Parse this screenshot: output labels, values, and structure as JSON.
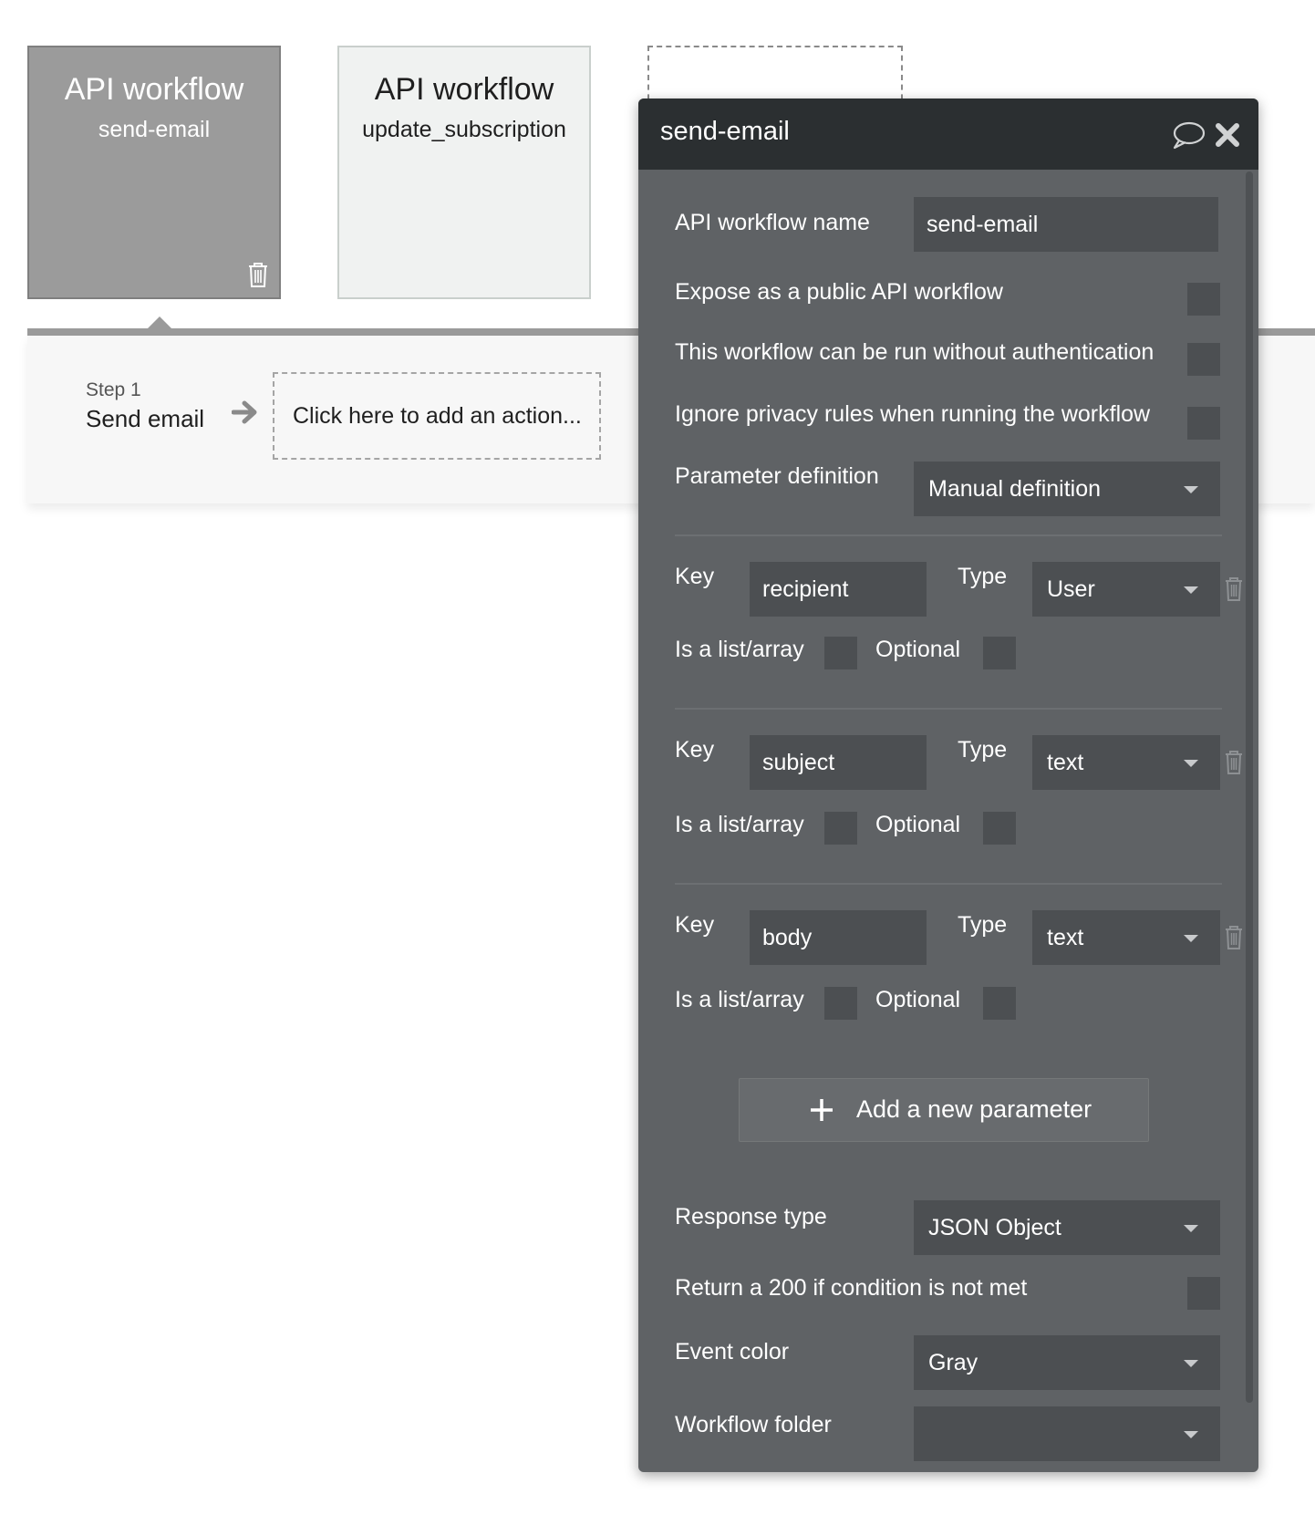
{
  "cards": [
    {
      "title": "API workflow",
      "subtitle": "send-email"
    },
    {
      "title": "API workflow",
      "subtitle": "update_subscription"
    }
  ],
  "step": {
    "number": "Step 1",
    "name": "Send email",
    "add_action": "Click here to add an action..."
  },
  "panel": {
    "title": "send-email",
    "workflow_name_label": "API workflow name",
    "workflow_name_value": "send-email",
    "expose_label": "Expose as a public API workflow",
    "no_auth_label": "This workflow can be run without authentication",
    "ignore_privacy_label": "Ignore privacy rules when running the workflow",
    "param_def_label": "Parameter definition",
    "param_def_value": "Manual definition",
    "params": [
      {
        "key_label": "Key",
        "key": "recipient",
        "type_label": "Type",
        "type": "User",
        "list_label": "Is a list/array",
        "optional_label": "Optional"
      },
      {
        "key_label": "Key",
        "key": "subject",
        "type_label": "Type",
        "type": "text",
        "list_label": "Is a list/array",
        "optional_label": "Optional"
      },
      {
        "key_label": "Key",
        "key": "body",
        "type_label": "Type",
        "type": "text",
        "list_label": "Is a list/array",
        "optional_label": "Optional"
      }
    ],
    "add_param_label": "Add a new parameter",
    "response_type_label": "Response type",
    "response_type_value": "JSON Object",
    "return_200_label": "Return a 200 if condition is not met",
    "event_color_label": "Event color",
    "event_color_value": "Gray",
    "folder_label": "Workflow folder",
    "folder_value": ""
  },
  "icons": {
    "trash": "trash-icon",
    "comment": "comment-icon",
    "close": "close-icon",
    "arrow": "arrow-right-icon",
    "plus": "plus-icon",
    "caret": "chevron-down-icon"
  },
  "colors": {
    "panel_bg": "#5f6265",
    "panel_header": "#2b2f31",
    "input_bg": "#4c4f52",
    "active_card": "#9b9b9b"
  }
}
